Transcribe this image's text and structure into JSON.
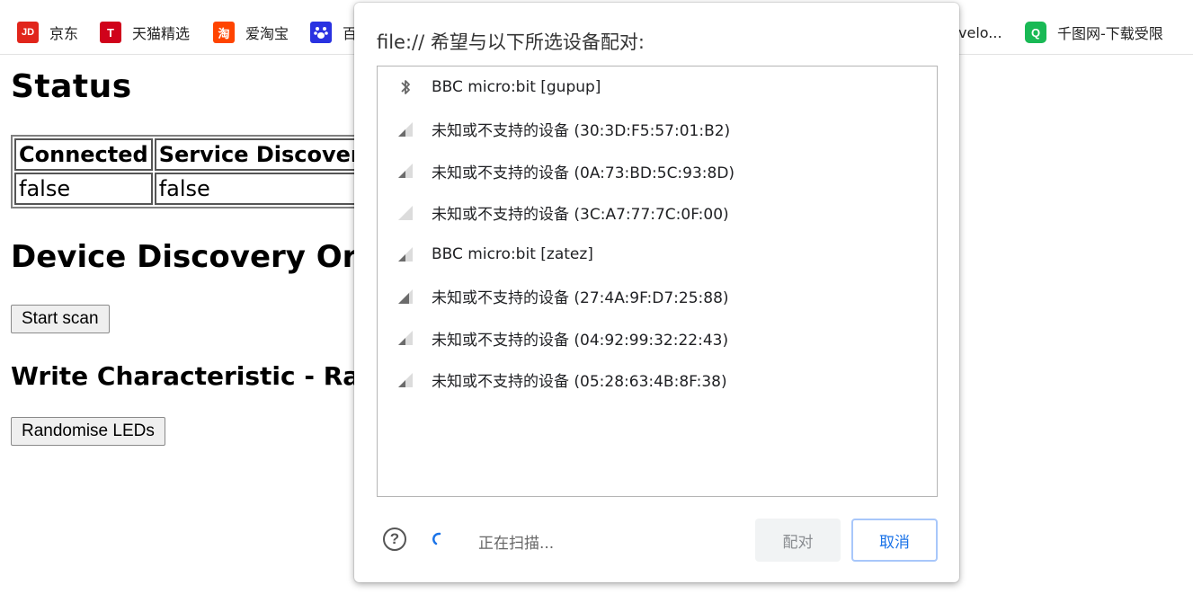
{
  "bookmarks": [
    {
      "label": "京东",
      "icon": "jd-icon",
      "glyph": "JD",
      "color": "#e1251b"
    },
    {
      "label": "天猫精选",
      "icon": "tmall-icon",
      "glyph": "T",
      "color": "#d0021b"
    },
    {
      "label": "爱淘宝",
      "icon": "taobao-icon",
      "glyph": "淘",
      "color": "#ff4400"
    },
    {
      "label": "百",
      "icon": "baidu-icon",
      "glyph": "🐾",
      "color": "#2932e1"
    },
    {
      "label": "velo...",
      "icon": "",
      "glyph": "",
      "color": ""
    },
    {
      "label": "千图网-下载受限",
      "icon": "qiantu-icon",
      "glyph": "Q",
      "color": "#19b955"
    }
  ],
  "page": {
    "status_heading": "Status",
    "table": {
      "headers": [
        "Connected",
        "Service Discovery co"
      ],
      "values": [
        "false",
        "false"
      ]
    },
    "discovery_heading": "Device Discovery Or I",
    "start_scan_label": "Start scan",
    "write_heading": "Write Characteristic - Rando",
    "randomise_label": "Randomise LEDs"
  },
  "dialog": {
    "title": "file:// 希望与以下所选设备配对:",
    "devices": [
      {
        "label": "BBC micro:bit [gupup]",
        "icon": "bluetooth-icon",
        "signal": 0
      },
      {
        "label": "未知或不支持的设备 (30:3D:F5:57:01:B2)",
        "icon": "signal-strength-icon",
        "signal": 2
      },
      {
        "label": "未知或不支持的设备 (0A:73:BD:5C:93:8D)",
        "icon": "signal-strength-icon",
        "signal": 2
      },
      {
        "label": "未知或不支持的设备 (3C:A7:77:7C:0F:00)",
        "icon": "signal-strength-icon",
        "signal": 0
      },
      {
        "label": "BBC micro:bit [zatez]",
        "icon": "signal-strength-icon",
        "signal": 2
      },
      {
        "label": "未知或不支持的设备 (27:4A:9F:D7:25:88)",
        "icon": "signal-strength-icon",
        "signal": 3
      },
      {
        "label": "未知或不支持的设备 (04:92:99:32:22:43)",
        "icon": "signal-strength-icon",
        "signal": 2
      },
      {
        "label": "未知或不支持的设备 (05:28:63:4B:8F:38)",
        "icon": "signal-strength-icon",
        "signal": 2
      }
    ],
    "help_glyph": "?",
    "scanning_text": "正在扫描...",
    "pair_label": "配对",
    "cancel_label": "取消"
  }
}
